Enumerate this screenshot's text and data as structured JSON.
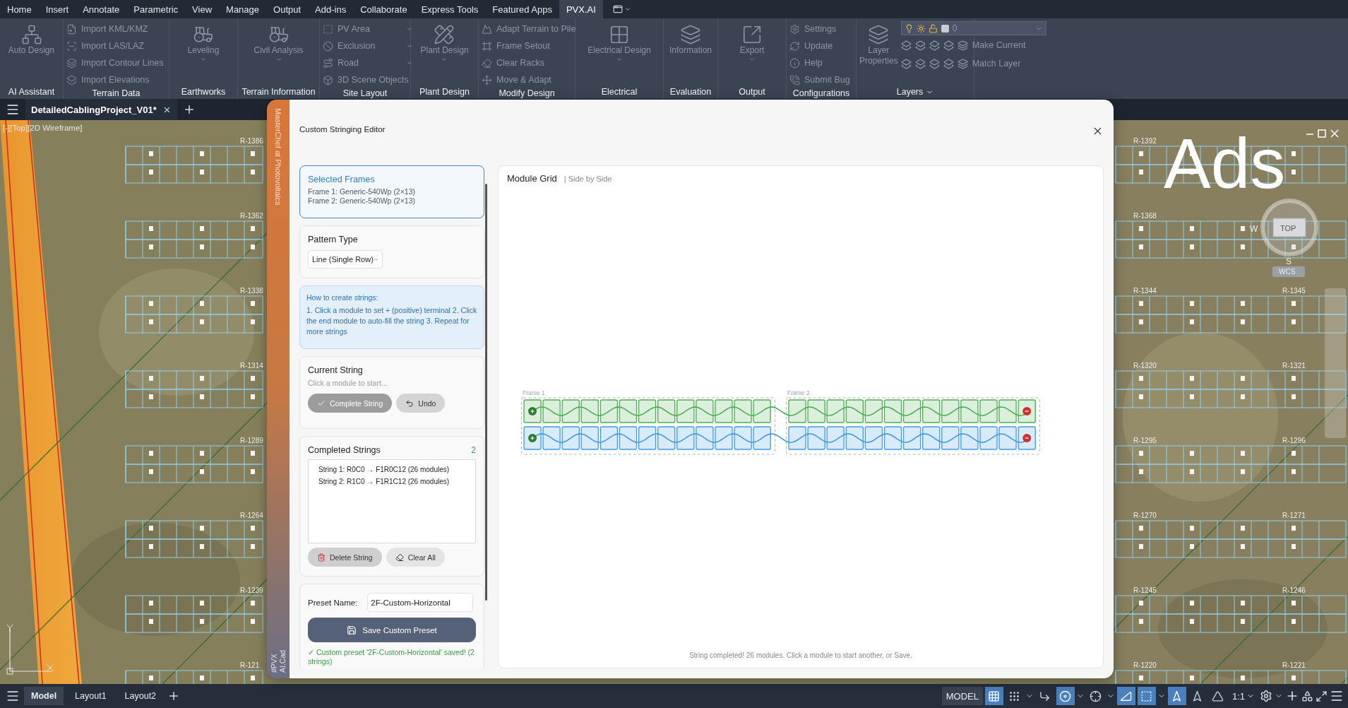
{
  "menu_tabs": [
    {
      "label": "Home",
      "selected": false
    },
    {
      "label": "Insert",
      "selected": false
    },
    {
      "label": "Annotate",
      "selected": false
    },
    {
      "label": "Parametric",
      "selected": false
    },
    {
      "label": "View",
      "selected": false
    },
    {
      "label": "Manage",
      "selected": false
    },
    {
      "label": "Output",
      "selected": false
    },
    {
      "label": "Add-ins",
      "selected": false
    },
    {
      "label": "Collaborate",
      "selected": false
    },
    {
      "label": "Express Tools",
      "selected": false
    },
    {
      "label": "Featured Apps",
      "selected": false
    },
    {
      "label": "PVX.AI",
      "selected": true
    }
  ],
  "ribbon": {
    "disabled": true,
    "panels": [
      {
        "title": "AI Assistant",
        "title_dropdown": false,
        "items": [
          {
            "kind": "large",
            "label": "Auto Design",
            "dropdown": false
          }
        ]
      },
      {
        "title": "Terrain Data",
        "title_dropdown": false,
        "items": [
          {
            "kind": "small",
            "label": "Import KML/KMZ",
            "dropdown": false
          },
          {
            "kind": "small",
            "label": "Import LAS/LAZ",
            "dropdown": false
          },
          {
            "kind": "small",
            "label": "Import Contour Lines",
            "dropdown": false
          },
          {
            "kind": "small",
            "label": "Import Elevations",
            "dropdown": false
          }
        ]
      },
      {
        "title": "Earthworks",
        "title_dropdown": false,
        "items": [
          {
            "kind": "large",
            "label": "Leveling",
            "dropdown": true
          }
        ]
      },
      {
        "title": "Terrain Information",
        "title_dropdown": false,
        "items": [
          {
            "kind": "large",
            "label": "Civil Analysis",
            "dropdown": true
          }
        ]
      },
      {
        "title": "Site Layout",
        "title_dropdown": false,
        "items": [
          {
            "kind": "small",
            "label": "PV Area",
            "dropdown": true
          },
          {
            "kind": "small",
            "label": "Exclusion",
            "dropdown": true
          },
          {
            "kind": "small",
            "label": "Road",
            "dropdown": true
          },
          {
            "kind": "small",
            "label": "3D Scene Objects",
            "dropdown": false
          }
        ]
      },
      {
        "title": "Plant Design",
        "title_dropdown": false,
        "items": [
          {
            "kind": "large",
            "label": "Plant Design",
            "dropdown": true
          }
        ]
      },
      {
        "title": "Modify Design",
        "title_dropdown": false,
        "items": [
          {
            "kind": "small",
            "label": "Adapt Terrain to Pile",
            "dropdown": false
          },
          {
            "kind": "small",
            "label": "Frame Setout",
            "dropdown": false
          },
          {
            "kind": "small",
            "label": "Clear Racks",
            "dropdown": false
          },
          {
            "kind": "small",
            "label": "Move & Adapt",
            "dropdown": false
          }
        ]
      },
      {
        "title": "Electrical",
        "title_dropdown": false,
        "items": [
          {
            "kind": "large",
            "label": "Electrical Design",
            "dropdown": true
          }
        ]
      },
      {
        "title": "Evaluation",
        "title_dropdown": false,
        "items": [
          {
            "kind": "large",
            "label": "Information",
            "dropdown": false
          }
        ]
      },
      {
        "title": "Output",
        "title_dropdown": false,
        "items": [
          {
            "kind": "large",
            "label": "Export",
            "dropdown": true
          }
        ]
      },
      {
        "title": "Configurations",
        "title_dropdown": false,
        "items": [
          {
            "kind": "small",
            "label": "Settings",
            "dropdown": false
          },
          {
            "kind": "small",
            "label": "Update",
            "dropdown": false
          },
          {
            "kind": "small",
            "label": "Help",
            "dropdown": false
          },
          {
            "kind": "small",
            "label": "Submit Bug",
            "dropdown": false
          }
        ]
      },
      {
        "title": "Layers",
        "title_dropdown": true,
        "items": [
          {
            "kind": "large",
            "label": "Layer Properties",
            "dropdown": false
          },
          {
            "kind": "layer_select",
            "value": "0"
          },
          {
            "kind": "tool_row",
            "label": "Make Current"
          },
          {
            "kind": "tool_row",
            "label": "Match Layer"
          }
        ]
      }
    ]
  },
  "file_tabs": [
    {
      "label": "DetailedCablingProject_V01*",
      "selected": true
    }
  ],
  "viewport": {
    "label": "[-][Top][2D Wireframe]",
    "overlay_text": "Ads",
    "row_labels_left": [
      "R-1386",
      "R-1362",
      "R-1338",
      "R-1314",
      "R-1289",
      "R-1264",
      "R-1239",
      "R-121"
    ],
    "row_labels_right": [
      [
        "R-1392"
      ],
      [
        "R-1368"
      ],
      [
        "R-1344",
        "R-1345"
      ],
      [
        "R-1320",
        "R-1321"
      ],
      [
        "R-1295",
        "R-1296"
      ],
      [
        "R-1270",
        "R-1271"
      ],
      [
        "R-1245",
        "R-1246"
      ],
      [
        "R-1220",
        "R-1221"
      ]
    ],
    "viewcube": {
      "top": "TOP",
      "west": "W",
      "south": "S",
      "ucs": "WCS"
    }
  },
  "dialog": {
    "side_title": "MasterChef at Photovoltaics",
    "side_footer": "#PVX AI.Cad",
    "title": "Custom Stringing Editor",
    "selected_frames": {
      "title": "Selected Frames",
      "lines": [
        "Frame 1: Generic-540Wp (2×13)",
        "Frame 2: Generic-540Wp (2×13)"
      ]
    },
    "pattern": {
      "label": "Pattern Type",
      "value": "Line (Single Row)"
    },
    "help": {
      "title": "How to create strings:",
      "text": "1. Click a module to set + (positive) terminal 2. Click the end module to auto-fill the string 3. Repeat for more strings"
    },
    "current": {
      "label": "Current String",
      "placeholder": "Click a module to start...",
      "buttons": [
        {
          "label": "Complete String",
          "disabled": true
        },
        {
          "label": "Undo",
          "disabled": false
        }
      ]
    },
    "completed": {
      "label": "Completed Strings",
      "count": "2",
      "items": [
        "String 1: R0C0 → F1R0C12 (26 modules)",
        "String 2: R1C0 → F1R1C12 (26 modules)"
      ],
      "buttons": [
        {
          "label": "Delete String",
          "disabled": false
        },
        {
          "label": "Clear All",
          "disabled": false
        }
      ]
    },
    "preset": {
      "label": "Preset Name:",
      "value": "2F-Custom-Horizontal",
      "save": "Save Custom Preset",
      "message": "✓ Custom preset '2F-Custom-Horizontal' saved! (2 strings)"
    },
    "grid": {
      "title": "Module Grid",
      "subtitle": "| Side by Side",
      "frames": [
        "Frame 1",
        "Frame 2"
      ],
      "strings": [
        {
          "color": "#4caf50"
        },
        {
          "color": "#3d9be9"
        }
      ],
      "status": "String completed! 26 modules. Click a module to start another, or Save."
    }
  },
  "status_bar": {
    "layout_tabs": [
      {
        "label": "Model",
        "selected": true
      },
      {
        "label": "Layout1",
        "selected": false
      },
      {
        "label": "Layout2",
        "selected": false
      }
    ],
    "model": "MODEL",
    "scale": "1:1",
    "toggles": [
      {
        "on": true,
        "dropdown": false
      },
      {
        "on": false,
        "dropdown": true
      },
      {
        "on": false,
        "dropdown": false
      },
      {
        "on": true,
        "dropdown": true
      },
      {
        "on": false,
        "dropdown": true
      },
      {
        "on": true,
        "dropdown": false
      },
      {
        "on": true,
        "dropdown": true
      },
      {
        "on": true,
        "dropdown": false
      },
      {
        "on": false,
        "dropdown": false
      },
      {
        "on": false,
        "dropdown": false
      }
    ]
  }
}
